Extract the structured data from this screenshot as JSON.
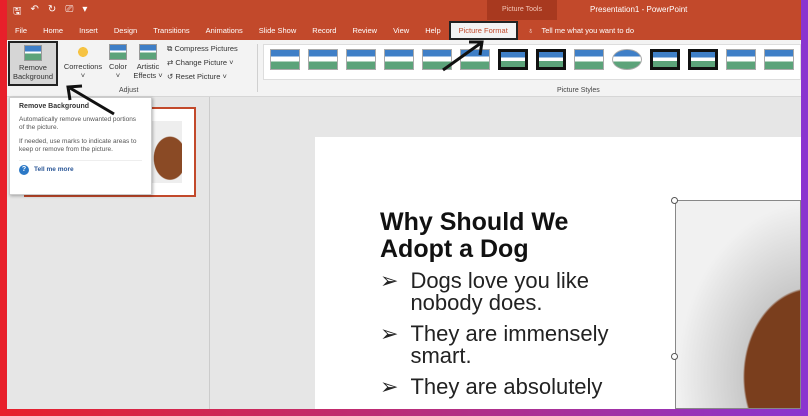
{
  "titlebar": {
    "context_tab": "Picture Tools",
    "app_title": "Presentation1  -  PowerPoint"
  },
  "tabs": [
    "File",
    "Home",
    "Insert",
    "Design",
    "Transitions",
    "Animations",
    "Slide Show",
    "Record",
    "Review",
    "View",
    "Help",
    "Picture Format"
  ],
  "tell_me": "Tell me what you want to do",
  "ribbon": {
    "remove_bg_1": "Remove",
    "remove_bg_2": "Background",
    "corrections": "Corrections",
    "color": "Color",
    "artistic_1": "Artistic",
    "artistic_2": "Effects",
    "compress": "Compress Pictures",
    "change": "Change Picture",
    "reset": "Reset Picture",
    "adjust_group": "Adjust",
    "styles_group": "Picture Styles"
  },
  "tooltip": {
    "title": "Remove Background",
    "p1": "Automatically remove unwanted portions of the picture.",
    "p2": "If needed, use marks to indicate areas to keep or remove from the picture.",
    "link": "Tell me more"
  },
  "slide": {
    "title": "Why Should We Adopt a Dog",
    "bullets": [
      "Dogs love you like nobody does.",
      "They are immensely smart.",
      "They are absolutely"
    ]
  }
}
